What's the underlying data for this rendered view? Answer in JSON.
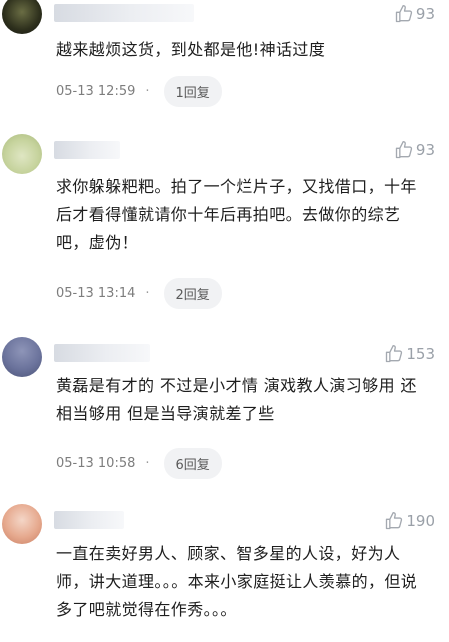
{
  "comments": [
    {
      "likes": "93",
      "text": "越来越烦这货，到处都是他!神话过度",
      "time": "05-13 12:59",
      "reply": "1回复"
    },
    {
      "likes": "93",
      "text": "求你躲躲粑粑。拍了一个烂片子，又找借口，十年后才看得懂就请你十年后再拍吧。去做你的综艺吧，虚伪！",
      "time": "05-13 13:14",
      "reply": "2回复"
    },
    {
      "likes": "153",
      "text": "黄磊是有才的 不过是小才情 演戏教人演习够用 还相当够用 但是当导演就差了些",
      "time": "05-13 10:58",
      "reply": "6回复"
    },
    {
      "likes": "190",
      "text": "一直在卖好男人、顾家、智多星的人设，好为人师，讲大道理。。。本来小家庭挺让人羡慕的，但说多了吧就觉得在作秀。。。"
    }
  ]
}
